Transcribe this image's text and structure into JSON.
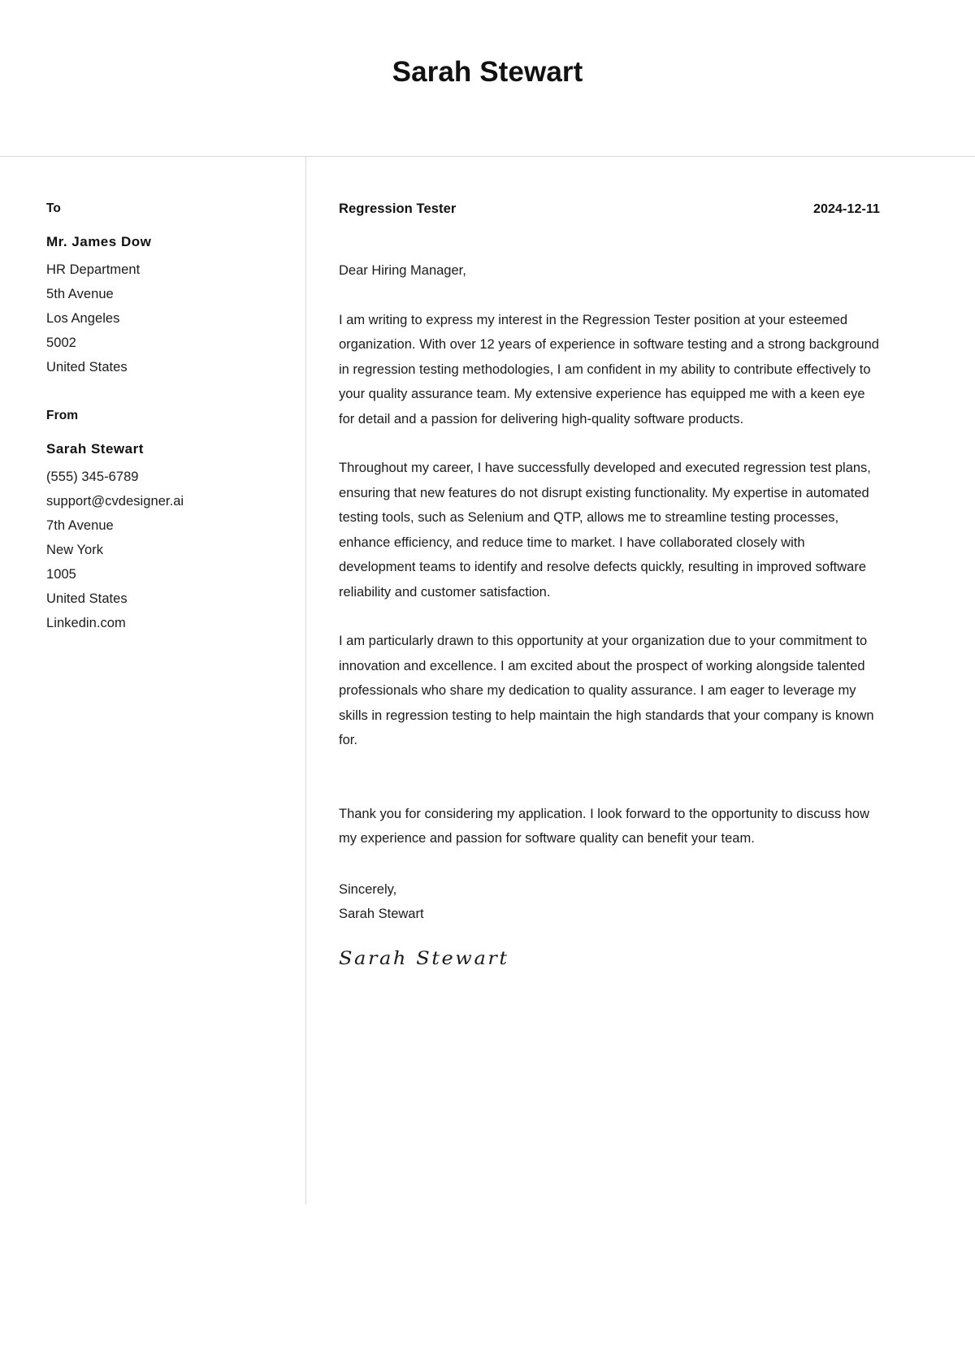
{
  "header": {
    "name": "Sarah Stewart"
  },
  "sidebar": {
    "to_heading": "To",
    "recipient": {
      "name": "Mr. James Dow",
      "lines": [
        "HR Department",
        "5th Avenue",
        "Los Angeles",
        "5002",
        "United States"
      ]
    },
    "from_heading": "From",
    "sender": {
      "name": "Sarah Stewart",
      "lines": [
        "(555) 345-6789",
        "support@cvdesigner.ai",
        "7th Avenue",
        "New York",
        "1005",
        "United States",
        "Linkedin.com"
      ]
    }
  },
  "letter": {
    "job_title": "Regression Tester",
    "date": "2024-12-11",
    "salutation": "Dear Hiring Manager,",
    "paragraphs": [
      "I am writing to express my interest in the Regression Tester position at your esteemed organization. With over 12 years of experience in software testing and a strong background in regression testing methodologies, I am confident in my ability to contribute effectively to your quality assurance team. My extensive experience has equipped me with a keen eye for detail and a passion for delivering high-quality software products.",
      "Throughout my career, I have successfully developed and executed regression test plans, ensuring that new features do not disrupt existing functionality. My expertise in automated testing tools, such as Selenium and QTP, allows me to streamline testing processes, enhance efficiency, and reduce time to market. I have collaborated closely with development teams to identify and resolve defects quickly, resulting in improved software reliability and customer satisfaction.",
      "I am particularly drawn to this opportunity at your organization due to your commitment to innovation and excellence. I am excited about the prospect of working alongside talented professionals who share my dedication to quality assurance. I am eager to leverage my skills in regression testing to help maintain the high standards that your company is known for.",
      "Thank you for considering my application. I look forward to the opportunity to discuss how my experience and passion for software quality can benefit your team."
    ],
    "closing_word": "Sincerely,",
    "closing_name": "Sarah Stewart",
    "signature": "Sarah Stewart"
  }
}
